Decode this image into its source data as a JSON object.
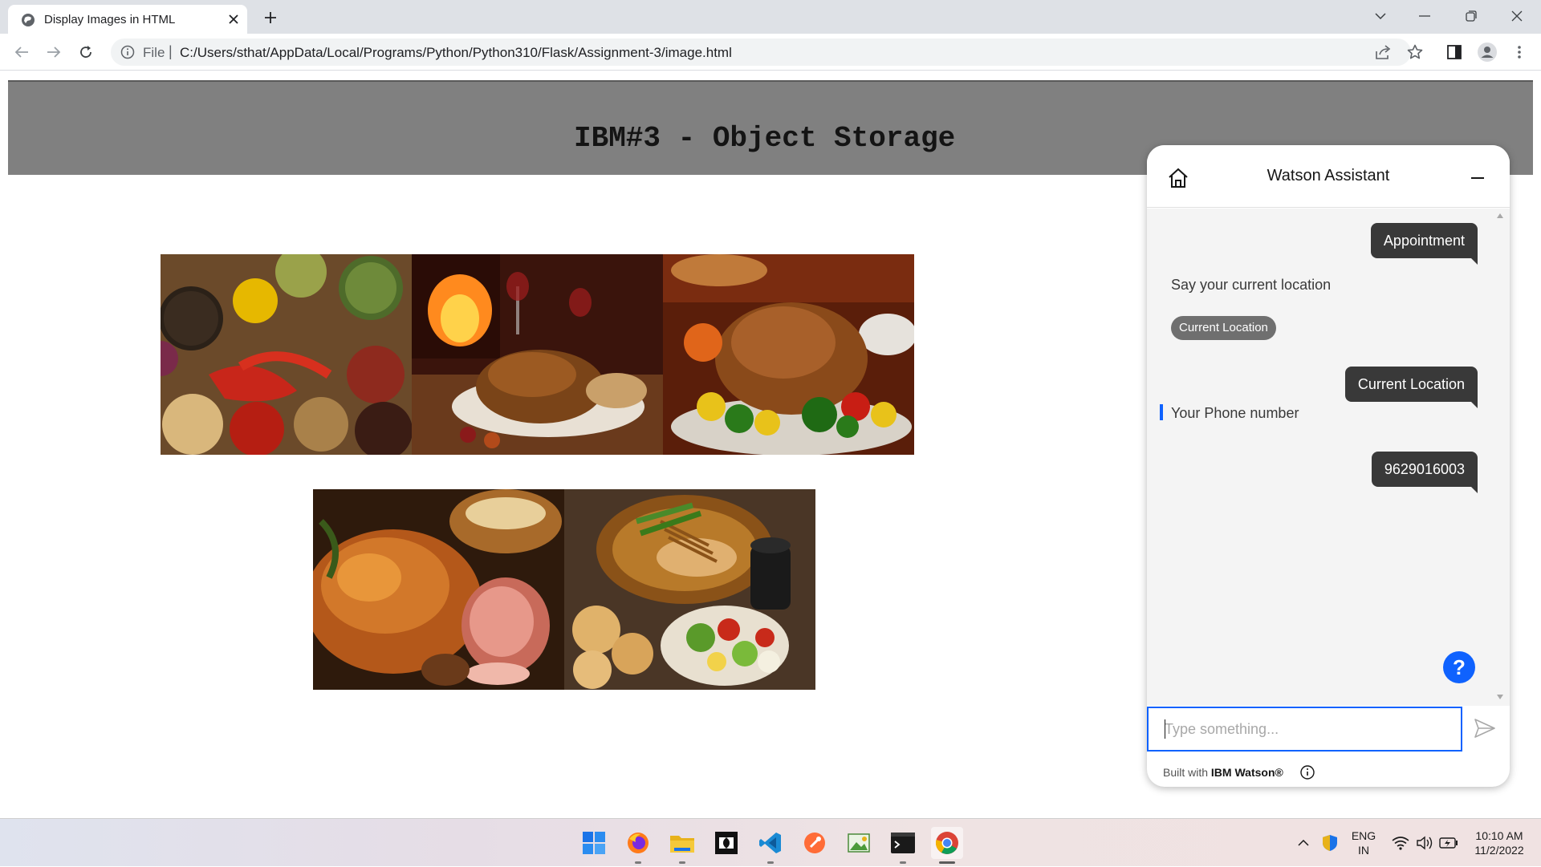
{
  "browser": {
    "tab_title": "Display Images in HTML",
    "address_prefix": "File",
    "address_separator": "|",
    "url": "C:/Users/sthat/AppData/Local/Programs/Python/Python310/Flask/Assignment-3/image.html"
  },
  "page": {
    "title": "IBM#3 - Object Storage",
    "images": [
      {
        "name": "spices-image",
        "subject": "spices"
      },
      {
        "name": "fireplace-turkey-image",
        "subject": "roast turkey by fireplace"
      },
      {
        "name": "turkey-vegetables-image",
        "subject": "roast turkey with vegetables"
      },
      {
        "name": "roast-chicken-ham-image",
        "subject": "roast chicken and ham"
      },
      {
        "name": "grilled-dinner-image",
        "subject": "grilled fish, bread rolls and salad"
      }
    ]
  },
  "assistant": {
    "title": "Watson Assistant",
    "messages": [
      {
        "from": "user",
        "text": "Appointment"
      },
      {
        "from": "bot",
        "text": "Say your current location"
      },
      {
        "from": "option",
        "text": "Current Location"
      },
      {
        "from": "user",
        "text": "Current Location"
      },
      {
        "from": "bot",
        "text": "Your Phone number"
      },
      {
        "from": "user",
        "text": "9629016003"
      }
    ],
    "help_label": "?",
    "input_placeholder": "Type something...",
    "footer_prefix": "Built with",
    "footer_brand": "IBM Watson®",
    "accent_color": "#0f62fe",
    "user_bubble_color": "#393939"
  },
  "taskbar": {
    "apps": [
      "windows-start",
      "firefox",
      "file-explorer",
      "dolby-access",
      "vscode",
      "postman",
      "gif-tool",
      "terminal",
      "chrome"
    ],
    "tray": {
      "language_top": "ENG",
      "language_bottom": "IN",
      "time": "10:10 AM",
      "date": "11/2/2022"
    }
  }
}
